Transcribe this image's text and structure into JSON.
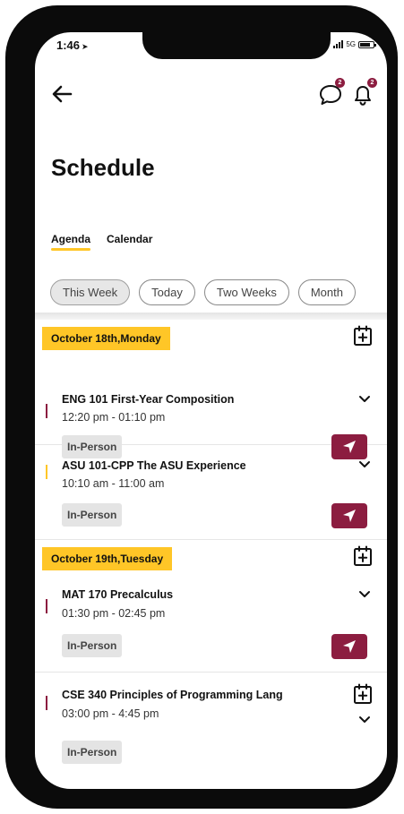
{
  "status": {
    "time": "1:46",
    "time_arrow": "➤",
    "network": "5G"
  },
  "header": {
    "message_badge": "2",
    "notification_badge": "2"
  },
  "page": {
    "title": "Schedule"
  },
  "tabs": [
    {
      "label": "Agenda"
    },
    {
      "label": "Calendar"
    }
  ],
  "filters": [
    {
      "label": "This Week"
    },
    {
      "label": "Today"
    },
    {
      "label": "Two Weeks"
    },
    {
      "label": "Month"
    }
  ],
  "days": [
    {
      "label": "October 18th,Monday",
      "events": [
        {
          "title": "ENG 101 First-Year Composition",
          "time": "12:20 pm - 01:10 pm",
          "mode": "In-Person",
          "accent": "#8c1d40"
        },
        {
          "title": "ASU 101-CPP The ASU Experience",
          "time": "10:10 am - 11:00 am",
          "mode": "In-Person",
          "accent": "#ffc627"
        }
      ]
    },
    {
      "label": "October 19th,Tuesday",
      "events": [
        {
          "title": "MAT 170 Precalculus",
          "time": "01:30 pm - 02:45 pm",
          "mode": "In-Person",
          "accent": "#8c1d40"
        },
        {
          "title": "CSE 340 Principles of Programming Lang",
          "time": "03:00 pm - 4:45 pm",
          "mode": "In-Person",
          "accent": "#8c1d40"
        }
      ]
    }
  ],
  "colors": {
    "maroon": "#8c1d40",
    "gold": "#ffc627"
  }
}
